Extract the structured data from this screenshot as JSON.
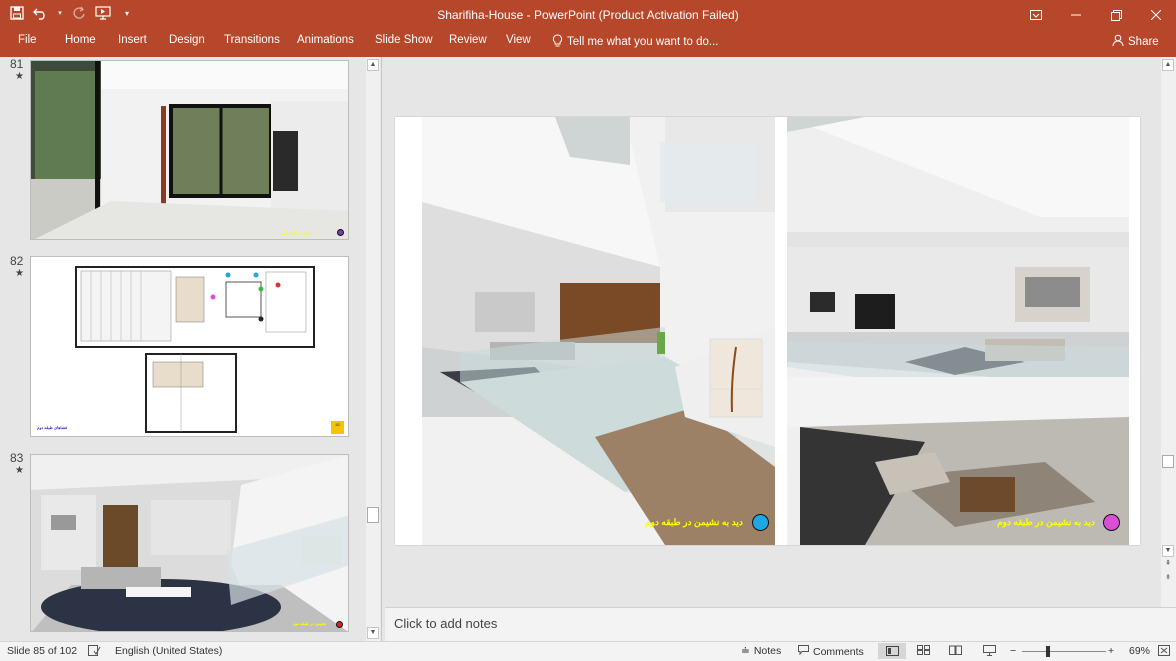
{
  "window": {
    "title": "Sharifiha-House - PowerPoint (Product Activation Failed)",
    "accent": "#b7472a"
  },
  "ribbon": {
    "tabs": [
      "File",
      "Home",
      "Insert",
      "Design",
      "Transitions",
      "Animations",
      "Slide Show",
      "Review",
      "View"
    ],
    "tell_me": "Tell me what you want to do...",
    "share": "Share"
  },
  "thumbnails": [
    {
      "number": "81",
      "star": "★",
      "caption": "نشیمن در طبقه اول"
    },
    {
      "number": "82",
      "star": "★",
      "caption": "فضاهای طبقه دوم",
      "badge": "82"
    },
    {
      "number": "83",
      "star": "★",
      "caption": "نشیمن در طبقه دوم"
    }
  ],
  "slide": {
    "left_caption": "دید به نشیمن در طبقه دوم",
    "right_caption": "دید به نشیمن در طبقه دوم",
    "left_dot_color": "#1ea7e1",
    "right_dot_color": "#d94fd6"
  },
  "notes": {
    "placeholder": "Click to add notes"
  },
  "status": {
    "slide_info": "Slide 85 of 102",
    "language": "English (United States)",
    "notes_label": "Notes",
    "comments_label": "Comments",
    "zoom": "69%"
  }
}
